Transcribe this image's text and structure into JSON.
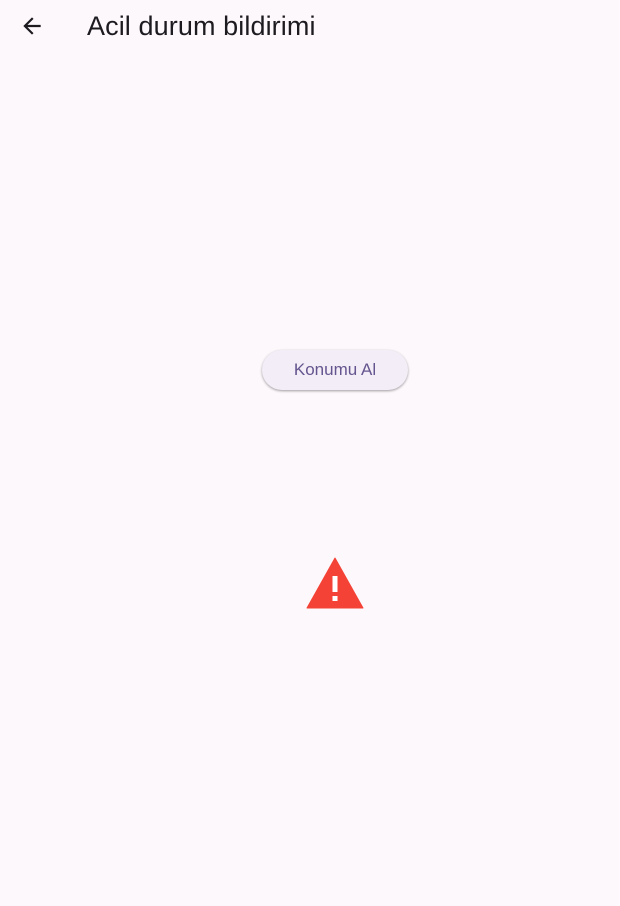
{
  "header": {
    "back_icon": "arrow-back-icon",
    "title": "Acil durum bildirimi"
  },
  "main": {
    "location_button_label": "Konumu Al",
    "warning_icon": "warning-triangle-icon",
    "warning_color": "#f44336"
  },
  "colors": {
    "background": "#fdf8fc",
    "button_background": "#f3edf7",
    "button_text": "#65558f"
  }
}
